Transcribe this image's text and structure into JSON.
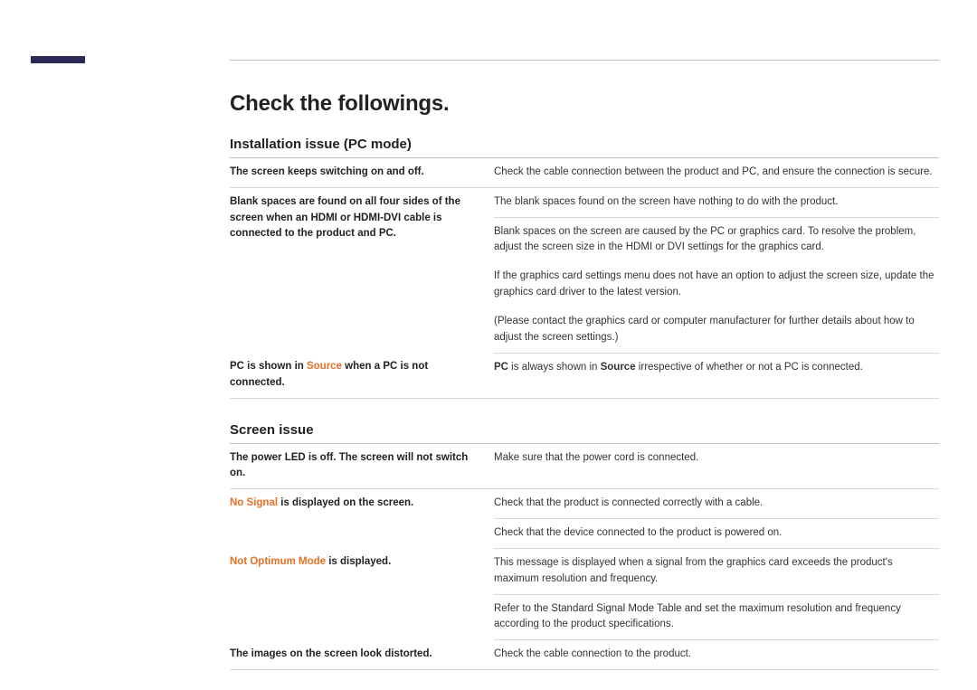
{
  "title": "Check the followings.",
  "section1": {
    "heading": "Installation issue (PC mode)",
    "rows": [
      {
        "left": "The screen keeps switching on and off.",
        "right": "Check the cable connection between the product and PC, and ensure the connection is secure."
      },
      {
        "left": "Blank spaces are found on all four sides of the screen when an HDMI or HDMI-DVI cable is connected to the product and PC.",
        "right_a": "The blank spaces found on the screen have nothing to do with the product.",
        "right_b": "Blank spaces on the screen are caused by the PC or graphics card. To resolve the problem, adjust the screen size in the HDMI or DVI settings for the graphics card.",
        "right_c": "If the graphics card settings menu does not have an option to adjust the screen size, update the graphics card driver to the latest version.",
        "right_d": "(Please contact the graphics card or computer manufacturer for further details about how to adjust the screen settings.)"
      },
      {
        "left_pre": "PC is shown in ",
        "left_orange": "Source",
        "left_post": " when a PC is not connected.",
        "right_pre": "",
        "right_b1": "PC",
        "right_mid": " is always shown in ",
        "right_b2": "Source",
        "right_post": " irrespective of whether or not a PC is connected."
      }
    ]
  },
  "section2": {
    "heading": "Screen issue",
    "rows": [
      {
        "left": "The power LED is off. The screen will not switch on.",
        "right": "Make sure that the power cord is connected."
      },
      {
        "left_orange": "No Signal",
        "left_post": " is displayed on the screen.",
        "right_a": "Check that the product is connected correctly with a cable.",
        "right_b": "Check that the device connected to the product is powered on."
      },
      {
        "left_orange": "Not Optimum Mode",
        "left_post": " is displayed.",
        "right_a": "This message is displayed when a signal from the graphics card exceeds the product's maximum resolution and frequency.",
        "right_b": "Refer to the Standard Signal Mode Table and set the maximum resolution and frequency according to the product specifications."
      },
      {
        "left": "The images on the screen look distorted.",
        "right": "Check the cable connection to the product."
      }
    ]
  }
}
